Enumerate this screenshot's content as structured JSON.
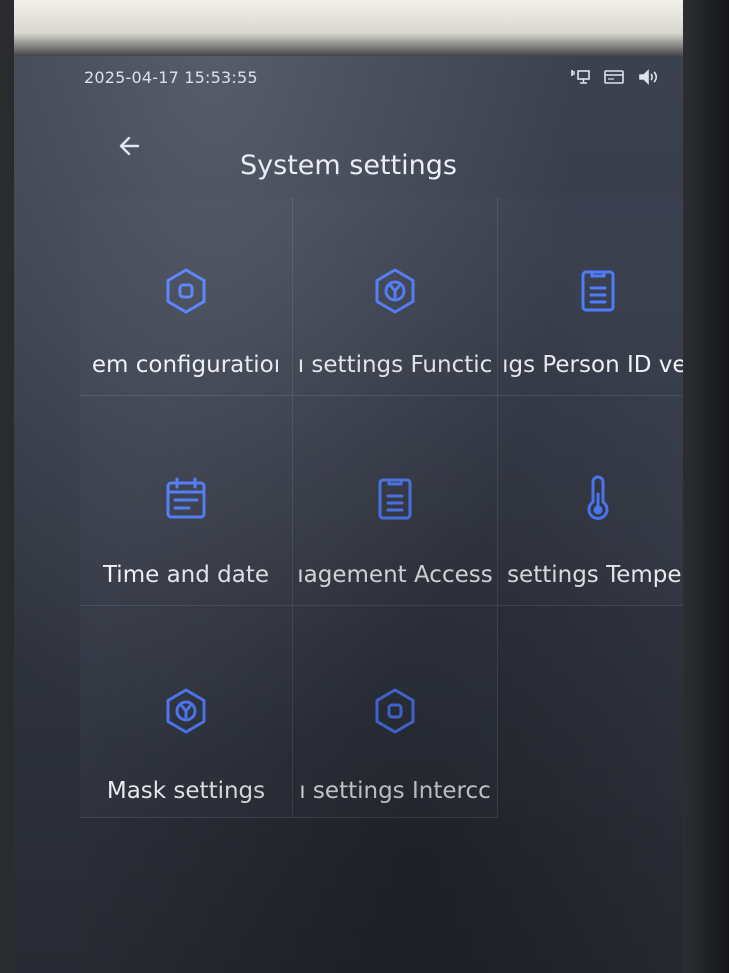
{
  "status": {
    "clock": "2025-04-17 15:53:55",
    "icons": [
      "network-icon",
      "card-icon",
      "speaker-icon"
    ]
  },
  "header": {
    "back_icon": "arrow-left-icon",
    "title": "System settings"
  },
  "tiles": [
    {
      "label": "em configuratioı",
      "icon": "hexagon-square-icon"
    },
    {
      "label": "ı settings Functic",
      "icon": "hexagon-y-icon"
    },
    {
      "label": "ıgs Person ID veı",
      "icon": "clipboard-icon"
    },
    {
      "label": "Time and date",
      "icon": "calendar-icon"
    },
    {
      "label": "ıagement Access",
      "icon": "clipboard-icon"
    },
    {
      "label": "settings Tempeı",
      "icon": "thermometer-icon"
    },
    {
      "label": "Mask settings",
      "icon": "hexagon-y-icon"
    },
    {
      "label": "ı settings Intercc",
      "icon": "hexagon-square-icon"
    }
  ],
  "colors": {
    "accent": "#4f7cff",
    "screen_bg": "#373c4a",
    "text": "#f2f4f8"
  }
}
